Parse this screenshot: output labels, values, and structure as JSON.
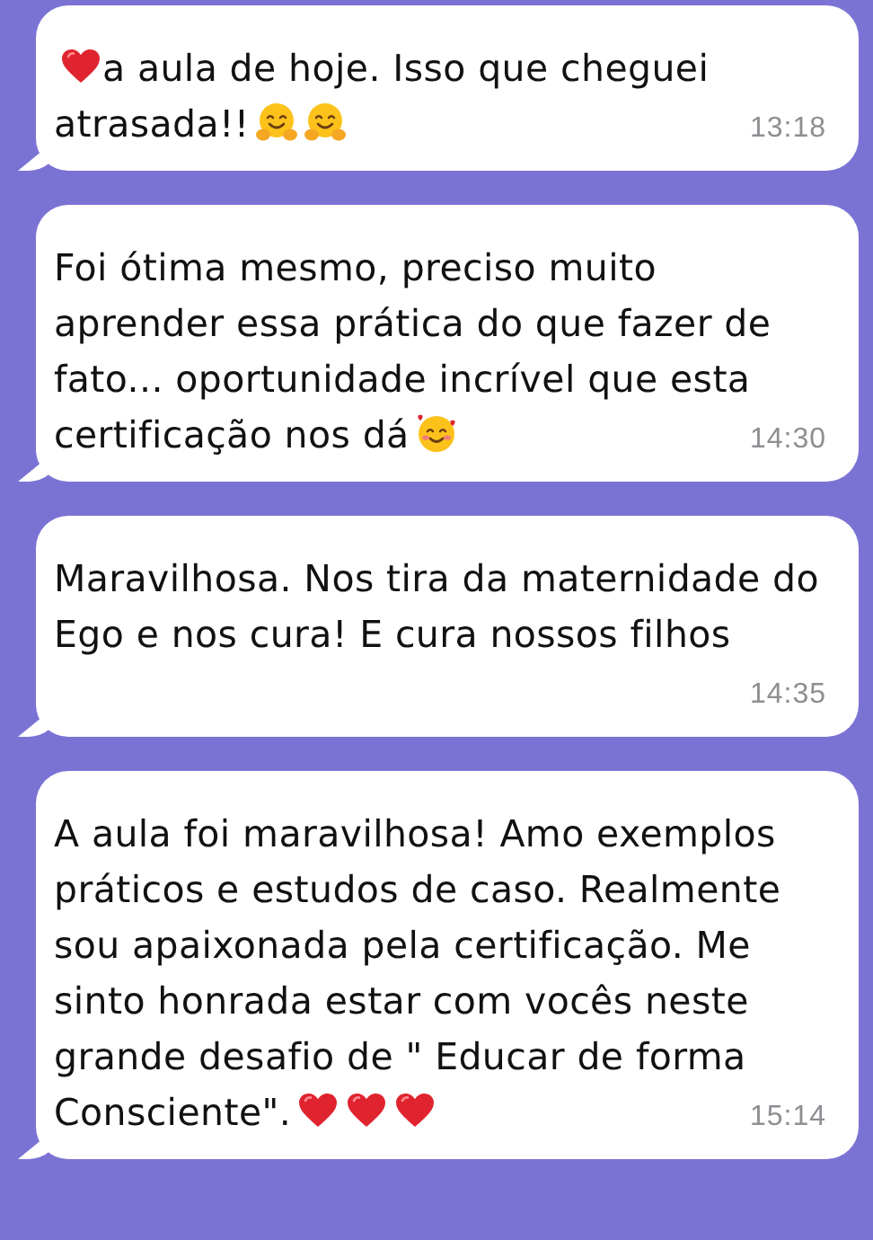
{
  "messages": [
    {
      "lines": [
        [
          {
            "kind": "heart"
          },
          {
            "kind": "text",
            "text": "a aula de hoje. Isso que cheguei"
          }
        ],
        [
          {
            "kind": "text",
            "text": "atrasada!!"
          },
          {
            "kind": "hug"
          },
          {
            "kind": "hug"
          }
        ]
      ],
      "time": "13:18"
    },
    {
      "lines": [
        [
          {
            "kind": "text",
            "text": "Foi ótima mesmo, preciso muito"
          }
        ],
        [
          {
            "kind": "text",
            "text": "aprender essa prática do que fazer de"
          }
        ],
        [
          {
            "kind": "text",
            "text": "fato... oportunidade incrível que esta"
          }
        ],
        [
          {
            "kind": "text",
            "text": "certificação nos dá"
          },
          {
            "kind": "smiling-hearts"
          }
        ]
      ],
      "time": "14:30"
    },
    {
      "lines": [
        [
          {
            "kind": "text",
            "text": "Maravilhosa. Nos tira da maternidade do"
          }
        ],
        [
          {
            "kind": "text",
            "text": "Ego e nos cura! E cura nossos filhos"
          }
        ]
      ],
      "time": "14:35"
    },
    {
      "lines": [
        [
          {
            "kind": "text",
            "text": "A aula foi maravilhosa! Amo exemplos"
          }
        ],
        [
          {
            "kind": "text",
            "text": "práticos e estudos de caso. Realmente"
          }
        ],
        [
          {
            "kind": "text",
            "text": "sou apaixonada pela certificação. Me"
          }
        ],
        [
          {
            "kind": "text",
            "text": "sinto honrada estar com vocês neste"
          }
        ],
        [
          {
            "kind": "text",
            "text": "grande desafio de \" Educar de forma"
          }
        ],
        [
          {
            "kind": "text",
            "text": "Consciente\"."
          },
          {
            "kind": "heart"
          },
          {
            "kind": "heart"
          },
          {
            "kind": "heart"
          }
        ]
      ],
      "time": "15:14"
    }
  ]
}
